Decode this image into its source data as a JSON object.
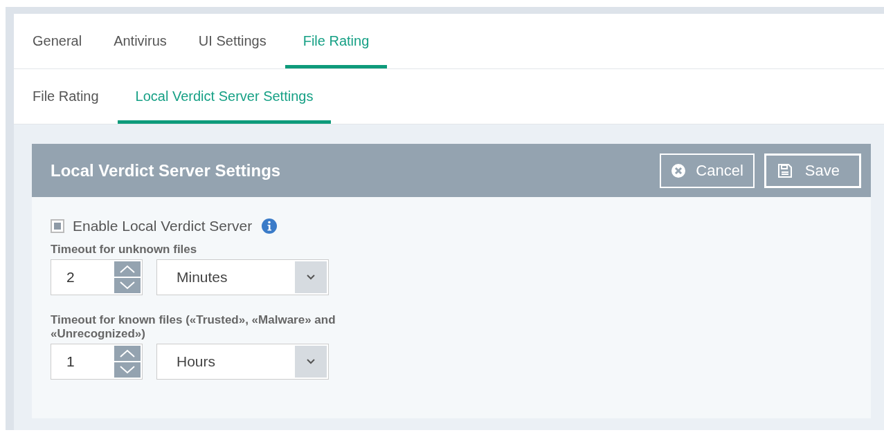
{
  "tabs": [
    {
      "label": "General",
      "selected": false
    },
    {
      "label": "Antivirus",
      "selected": false
    },
    {
      "label": "UI Settings",
      "selected": false
    },
    {
      "label": "File Rating",
      "selected": true
    }
  ],
  "subtabs": [
    {
      "label": "File Rating",
      "selected": false
    },
    {
      "label": "Local Verdict Server Settings",
      "selected": true
    }
  ],
  "panel": {
    "title": "Local Verdict Server Settings",
    "buttons": [
      {
        "kind": "cancel",
        "label": "Cancel",
        "primary": false
      },
      {
        "kind": "save",
        "label": "Save",
        "primary": true
      }
    ],
    "enable": {
      "label": "Enable Local Verdict Server",
      "checked": true
    },
    "timeouts": [
      {
        "label": "Timeout for unknown files",
        "value": "2",
        "unit": "Minutes"
      },
      {
        "label": "Timeout for known files («Trusted», «Malware» and «Unrecognized»)",
        "value": "1",
        "unit": "Hours"
      }
    ]
  }
}
